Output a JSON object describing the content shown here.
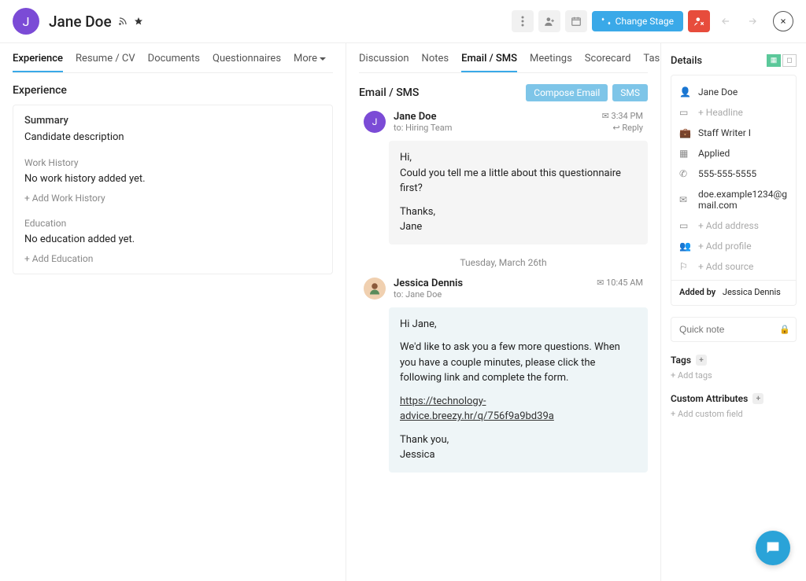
{
  "header": {
    "avatar_initial": "J",
    "candidate_name": "Jane Doe",
    "change_stage_label": "Change Stage"
  },
  "left_tabs": [
    "Experience",
    "Resume / CV",
    "Documents",
    "Questionnaires",
    "More"
  ],
  "left_active_tab": 0,
  "experience": {
    "title": "Experience",
    "summary_label": "Summary",
    "summary_text": "Candidate description",
    "work_history_label": "Work History",
    "work_history_text": "No work history added yet.",
    "add_work_history": "+ Add Work History",
    "education_label": "Education",
    "education_text": "No education added yet.",
    "add_education": "+ Add Education"
  },
  "mid_tabs": [
    "Discussion",
    "Notes",
    "Email / SMS",
    "Meetings",
    "Scorecard",
    "Tasks"
  ],
  "mid_active_tab": 2,
  "mid": {
    "title": "Email / SMS",
    "compose_email": "Compose Email",
    "sms": "SMS"
  },
  "messages": [
    {
      "avatar_initial": "J",
      "from": "Jane Doe",
      "to": "to: Hiring Team",
      "time": "3:34 PM",
      "reply": "Reply",
      "body": [
        "Hi,",
        "Could you tell me a little about this questionnaire first?",
        "Thanks,\nJane"
      ]
    }
  ],
  "date_separator": "Tuesday, March 26th",
  "messages2": [
    {
      "from": "Jessica Dennis",
      "to": "to: Jane Doe",
      "time": "10:45 AM",
      "body_greeting": "Hi Jane,",
      "body_main": "We'd like to ask you a few more questions. When you have a couple minutes, please click the following link and complete the form.",
      "body_link": "https://technology-advice.breezy.hr/q/756f9a9bd39a",
      "body_close": "Thank you,\nJessica"
    }
  ],
  "details": {
    "title": "Details",
    "name": "Jane Doe",
    "headline_placeholder": "+ Headline",
    "position": "Staff Writer I",
    "status": "Applied",
    "phone": "555-555-5555",
    "email": "doe.example1234@gmail.com",
    "address_placeholder": "+ Add address",
    "profile_placeholder": "+ Add profile",
    "source_placeholder": "+ Add source",
    "added_by_label": "Added by",
    "added_by_value": "Jessica Dennis"
  },
  "quicknote_placeholder": "Quick note",
  "tags": {
    "label": "Tags",
    "add": "+ Add tags"
  },
  "custom_attrs": {
    "label": "Custom Attributes",
    "add": "+ Add custom field"
  }
}
